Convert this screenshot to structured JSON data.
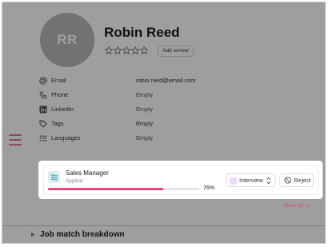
{
  "profile": {
    "initials": "RR",
    "name": "Robin Reed",
    "add_review_label": "Add review",
    "rating": {
      "value": 0,
      "max": 5
    }
  },
  "fields": [
    {
      "label": "Email",
      "value": "robin.reed@email.com",
      "icon": "at-icon"
    },
    {
      "label": "Phone",
      "value": "Empty",
      "icon": "phone-icon"
    },
    {
      "label": "LinkedIn",
      "value": "Empty",
      "icon": "linkedin-icon"
    },
    {
      "label": "Tags",
      "value": "Empty",
      "icon": "tag-icon"
    },
    {
      "label": "Languages",
      "value": "Empty",
      "icon": "list-icon"
    }
  ],
  "application": {
    "job_title": "Sales Manager",
    "status": "Applied",
    "match_percent": 76,
    "match_label": "76%",
    "stage": "Interview",
    "reject_label": "Reject"
  },
  "show_all_label": "Show all",
  "section": {
    "title": "Job match breakdown"
  },
  "colors": {
    "accent": "#e04a7a",
    "menu_icon": "#e57a8f",
    "avatar_bg": "#b8b8b8",
    "stage_swatch": "#ecdcfb",
    "job_icon_bg": "#d8eef1"
  }
}
